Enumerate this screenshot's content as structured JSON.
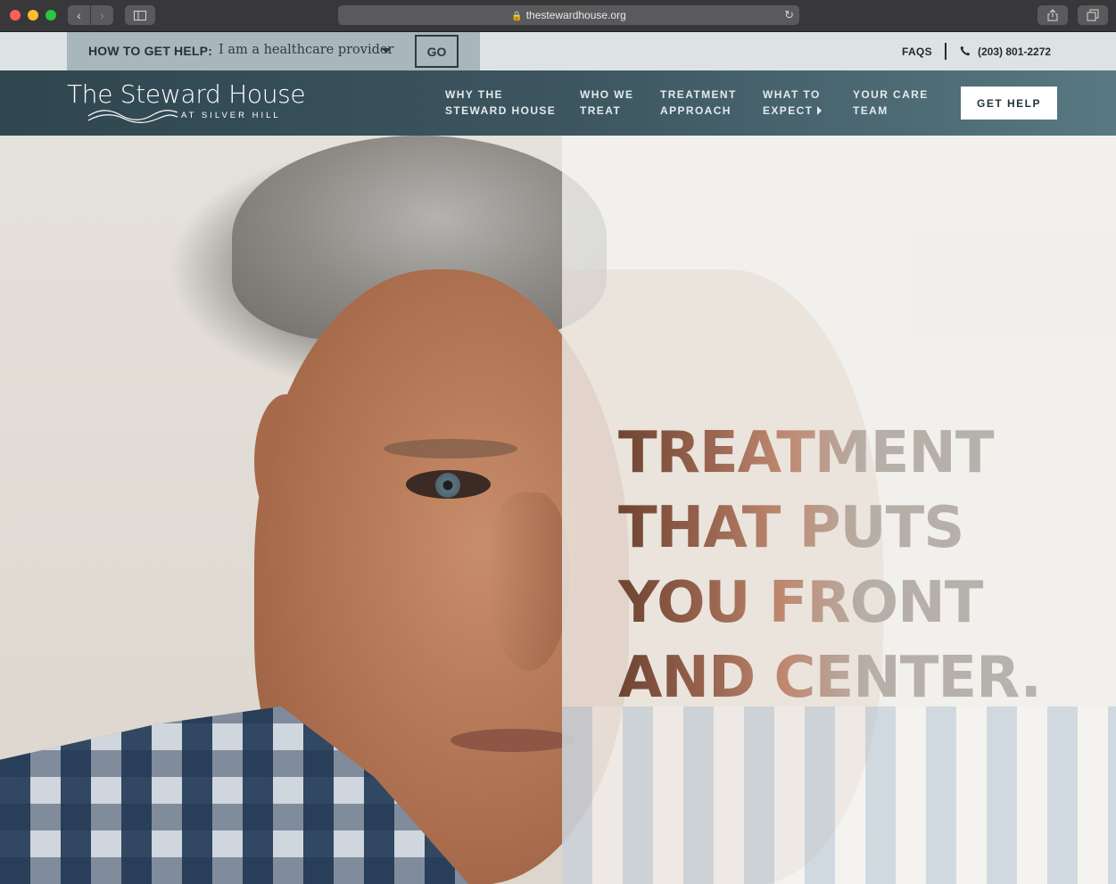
{
  "browser": {
    "url": "thestewardhouse.org"
  },
  "utility": {
    "help_label": "HOW TO GET HELP:",
    "help_selected": "I am a healthcare provider",
    "go_label": "GO",
    "faqs": "FAQS",
    "phone": "(203) 801-2272"
  },
  "logo": {
    "title": "The Steward House",
    "subtitle": "AT SILVER HILL"
  },
  "nav": {
    "items": [
      {
        "line1": "WHY THE",
        "line2": "STEWARD HOUSE"
      },
      {
        "line1": "WHO WE",
        "line2": "TREAT"
      },
      {
        "line1": "TREATMENT",
        "line2": "APPROACH"
      },
      {
        "line1": "WHAT TO",
        "line2": "EXPECT"
      },
      {
        "line1": "YOUR CARE",
        "line2": "TEAM"
      }
    ],
    "cta": "GET HELP"
  },
  "hero": {
    "headline": [
      "TREATMENT",
      "THAT PUTS",
      "YOU FRONT",
      "AND CENTER."
    ]
  }
}
